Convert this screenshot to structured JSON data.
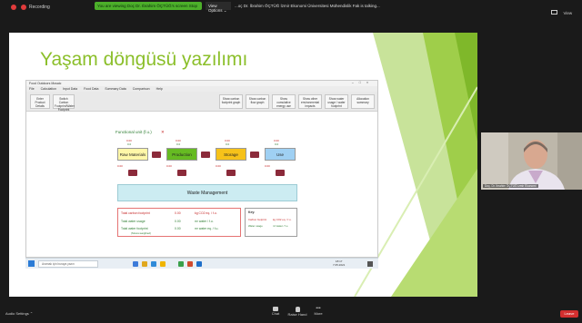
{
  "topbar": {
    "recording_label": "Recording",
    "share_banner": "You are viewing Doç Dr. Ibrahim ÖÇTÜĞ’s screen  Stop",
    "view_options": "View Options ⌄",
    "talking": "...oç Dr. İbrahim ÖÇTÜĞ İzmir Ekonomi Üniversitesi Mühendislik Fak is talking..."
  },
  "slide": {
    "title": "Yaşam döngüsü yazılımı"
  },
  "app": {
    "window_title": "Food Outdoors Mosaic",
    "menu": [
      "File",
      "Calculation",
      "Input Data",
      "Food Data",
      "Summary Data",
      "Comparison",
      "Help"
    ],
    "toolbar_left": [
      "Enter Product Details",
      "Switch Carbon Footprint/Water Footprint"
    ],
    "toolbar_right": [
      "Show carbon footprint graph",
      "Show carbon flow graph",
      "Show cumulative energy use",
      "Show other environmental impacts",
      "Show water usage / water footprint",
      "Allocation summary"
    ],
    "functional_unit": "Functional unit (f.u.)",
    "stages": [
      {
        "label": "Raw Materials",
        "color": "#fff7a8",
        "v1": "0.00",
        "v2": "0.0"
      },
      {
        "label": "Production",
        "color": "#66bb22",
        "v1": "0.00",
        "v2": "0.0"
      },
      {
        "label": "Storage",
        "color": "#f6c21a",
        "v1": "0.00",
        "v2": "0.0"
      },
      {
        "label": "Use",
        "color": "#9fd0f3",
        "v1": "0.00",
        "v2": "0.0"
      }
    ],
    "transport_value": "0.00",
    "waste_label": "Waste Management",
    "totals": [
      {
        "label": "Total carbon footprint",
        "value": "0.00",
        "unit": "kg CO2 eq. / f.u.",
        "color": "#c62828"
      },
      {
        "label": "Total water usage",
        "value": "0.00",
        "unit": "m³ water / f.u.",
        "color": "#2e7d32"
      },
      {
        "label": "Total water footprint",
        "value": "0.00",
        "unit": "m³ water eq. / f.u.",
        "color": "#2e7d32"
      }
    ],
    "totals_note": "(Stress-weighted)",
    "right_box": {
      "heading": "Key:",
      "carbon": "Carbon footprint",
      "carbon_unit": "kg CO2 eq. / f.u.",
      "water": "Water usage",
      "water_unit": "m³ water / f.u."
    }
  },
  "taskbar": {
    "search_placeholder": "Aramak için buraya yazın",
    "time": "18:17",
    "date": "7.05.2021"
  },
  "webcam": {
    "name": "Doç. Dr. İbrahim ÖÇTÜĞ İzmir Ekonomi"
  },
  "bottombar": {
    "audio_settings": "Audio Settings ⌃",
    "chat": "Chat",
    "raise_hand": "Raise Hand",
    "more": "More",
    "leave": "Leave"
  }
}
